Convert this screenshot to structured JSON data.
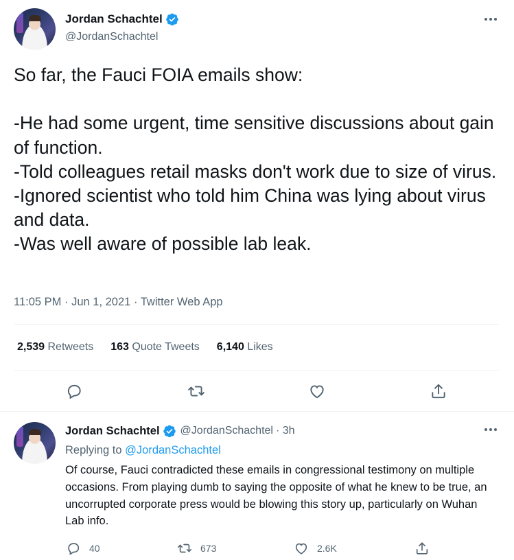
{
  "main_tweet": {
    "author": {
      "display_name": "Jordan Schachtel",
      "handle": "@JordanSchachtel"
    },
    "text": "So far, the Fauci FOIA emails show:\n\n-He had some urgent, time sensitive discussions about gain of function.\n-Told colleagues retail masks don't work due to size of virus.\n-Ignored scientist who told him China was lying about virus and data.\n-Was well aware of possible lab leak.",
    "time": "11:05 PM",
    "date": "Jun 1, 2021",
    "source": "Twitter Web App",
    "separator": "·",
    "stats": {
      "retweets_count": "2,539",
      "retweets_label": "Retweets",
      "quotes_count": "163",
      "quotes_label": "Quote Tweets",
      "likes_count": "6,140",
      "likes_label": "Likes"
    }
  },
  "reply_tweet": {
    "author": {
      "display_name": "Jordan Schachtel",
      "handle": "@JordanSchachtel"
    },
    "age": "· 3h",
    "replying_prefix": "Replying to",
    "replying_to": "@JordanSchachtel",
    "text": "Of course, Fauci contradicted these emails in congressional testimony on multiple occasions. From playing dumb to saying the opposite of what he knew to be true, an uncorrupted corporate press would be blowing this story up, particularly on Wuhan Lab info.",
    "counts": {
      "replies": "40",
      "retweets": "673",
      "likes": "2.6K"
    }
  },
  "colors": {
    "accent": "#1d9bf0",
    "text": "#0f1419",
    "secondary": "#536471",
    "divider": "#eff3f4"
  },
  "icons": [
    "verified-badge-icon",
    "more-icon",
    "reply-icon",
    "retweet-icon",
    "like-icon",
    "share-icon"
  ]
}
